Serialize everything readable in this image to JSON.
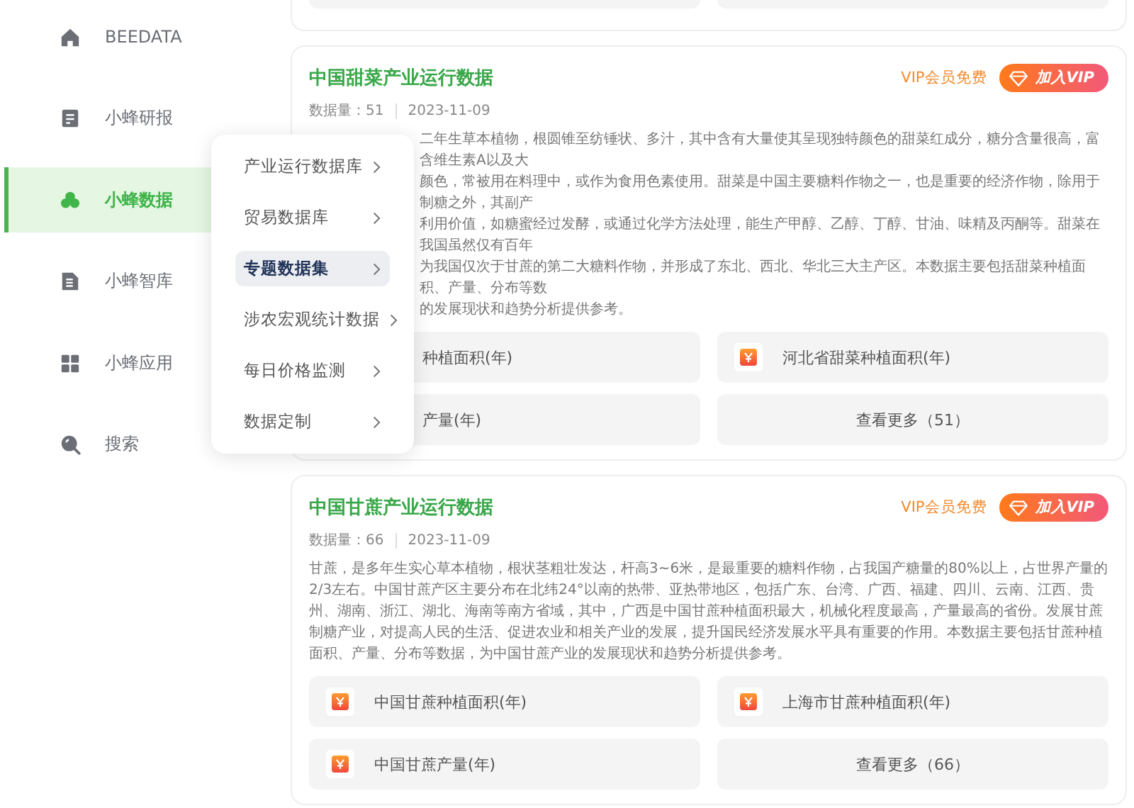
{
  "sidebar": {
    "items": [
      {
        "label": "BEEDATA",
        "selected": false
      },
      {
        "label": "小蜂研报",
        "selected": false
      },
      {
        "label": "小蜂数据",
        "selected": true
      },
      {
        "label": "小蜂智库",
        "selected": false
      },
      {
        "label": "小蜂应用",
        "selected": false
      },
      {
        "label": "搜索",
        "selected": false
      }
    ]
  },
  "menu": {
    "items": [
      {
        "label": "产业运行数据库",
        "selected": false
      },
      {
        "label": "贸易数据库",
        "selected": false
      },
      {
        "label": "专题数据集",
        "selected": true
      },
      {
        "label": "涉农宏观统计数据",
        "selected": false
      },
      {
        "label": "每日价格监测",
        "selected": false
      },
      {
        "label": "数据定制",
        "selected": false
      }
    ]
  },
  "cards": [
    {
      "title": "中国甜菜产业运行数据",
      "vip_note": "VIP会员免费",
      "vip_button": "加入VIP",
      "count": "数据量：51",
      "date": "2023-11-09",
      "description": {
        "kind": "clipped",
        "lines": [
          "二年生草本植物，根圆锥至纺锤状、多汁，其中含有大量使其呈现独特颜色的甜菜红成分，糖分含量很高，富含维生素A以及大",
          "颜色，常被用在料理中，或作为食用色素使用。甜菜是中国主要糖料作物之一，也是重要的经济作物，除用于制糖之外，其副产",
          "利用价值，如糖蜜经过发酵，或通过化学方法处理，能生产甲醇、乙醇、丁醇、甘油、味精及丙酮等。甜菜在我国虽然仅有百年",
          "为我国仅次于甘蔗的第二大糖料作物，并形成了东北、西北、华北三大主产区。本数据主要包括甜菜种植面积、产量、分布等数",
          "的发展现状和趋势分析提供参考。"
        ]
      },
      "tiles": [
        {
          "kind": "clipped",
          "label": "种植面积(年)"
        },
        {
          "kind": "dataset",
          "label": "河北省甜菜种植面积(年)"
        },
        {
          "kind": "clipped",
          "label": "产量(年)"
        },
        {
          "kind": "more",
          "label": "查看更多（51）"
        }
      ]
    },
    {
      "title": "中国甘蔗产业运行数据",
      "vip_note": "VIP会员免费",
      "vip_button": "加入VIP",
      "count": "数据量：66",
      "date": "2023-11-09",
      "description": {
        "kind": "full",
        "text": "甘蔗，是多年生实心草本植物，根状茎粗壮发达，杆高3~6米，是最重要的糖料作物，占我国产糖量的80%以上，占世界产量的2/3左右。中国甘蔗产区主要分布在北纬24°以南的热带、亚热带地区，包括广东、台湾、广西、福建、四川、云南、江西、贵州、湖南、浙江、湖北、海南等南方省域，其中，广西是中国甘蔗种植面积最大，机械化程度最高，产量最高的省份。发展甘蔗制糖产业，对提高人民的生活、促进农业和相关产业的发展，提升国民经济发展水平具有重要的作用。本数据主要包括甘蔗种植面积、产量、分布等数据，为中国甘蔗产业的发展现状和趋势分析提供参考。"
      },
      "tiles": [
        {
          "kind": "dataset",
          "label": "中国甘蔗种植面积(年)"
        },
        {
          "kind": "dataset",
          "label": "上海市甘蔗种植面积(年)"
        },
        {
          "kind": "dataset",
          "label": "中国甘蔗产量(年)"
        },
        {
          "kind": "more",
          "label": "查看更多（66）"
        }
      ]
    }
  ]
}
